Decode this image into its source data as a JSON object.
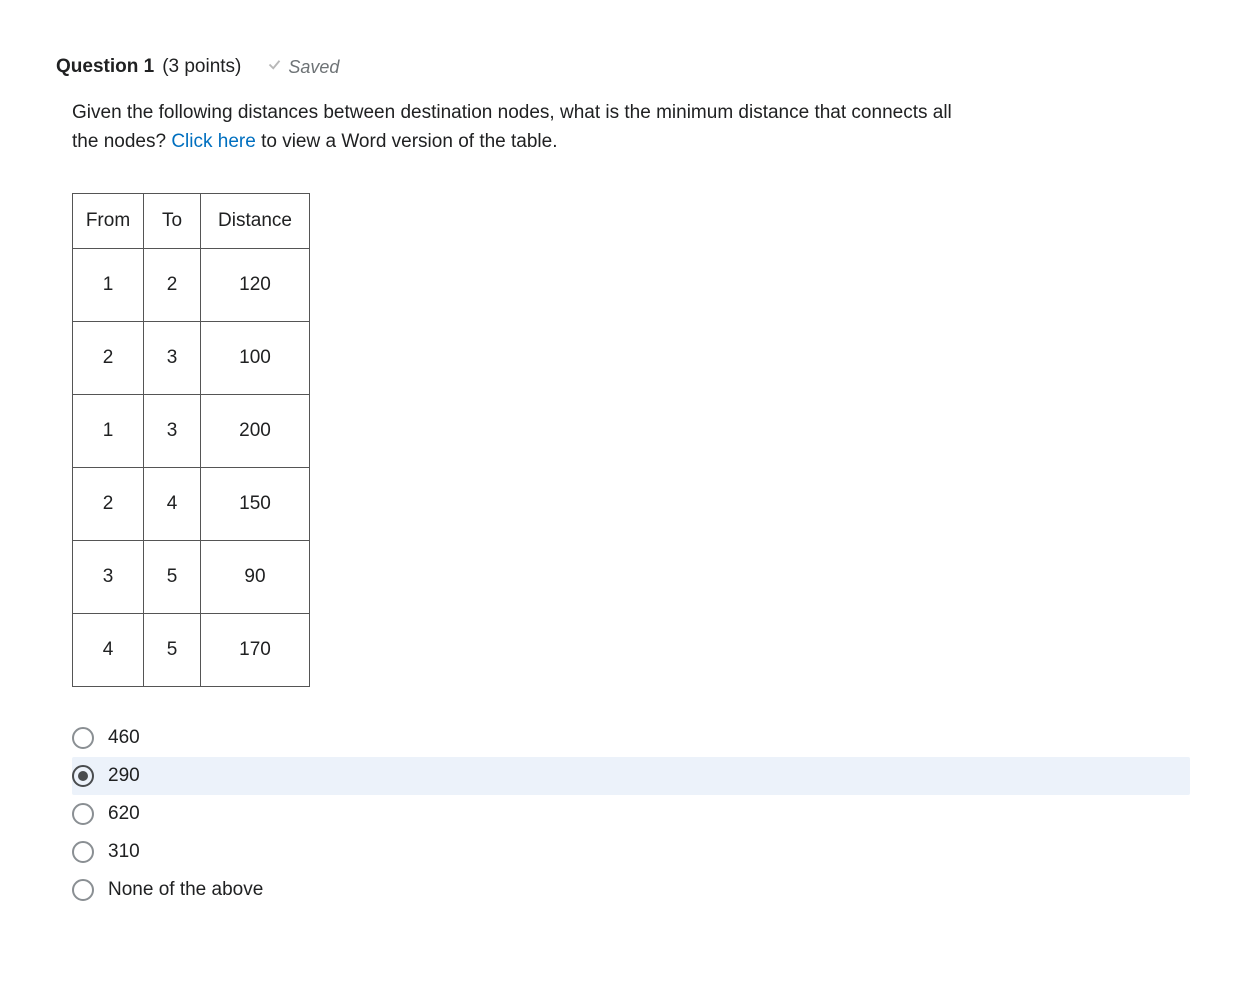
{
  "question": {
    "title": "Question 1",
    "points_text": "(3 points)",
    "saved_label": "Saved",
    "prompt_before_link": "Given the following distances between destination nodes, what is the minimum distance that connects all the nodes? ",
    "link_text": "Click here",
    "prompt_after_link": " to view a Word version of the table."
  },
  "table": {
    "headers": [
      "From",
      "To",
      "Distance"
    ],
    "rows": [
      [
        "1",
        "2",
        "120"
      ],
      [
        "2",
        "3",
        "100"
      ],
      [
        "1",
        "3",
        "200"
      ],
      [
        "2",
        "4",
        "150"
      ],
      [
        "3",
        "5",
        "90"
      ],
      [
        "4",
        "5",
        "170"
      ]
    ]
  },
  "options": [
    {
      "label": "460",
      "selected": false
    },
    {
      "label": "290",
      "selected": true
    },
    {
      "label": "620",
      "selected": false
    },
    {
      "label": "310",
      "selected": false
    },
    {
      "label": "None of the above",
      "selected": false
    }
  ]
}
